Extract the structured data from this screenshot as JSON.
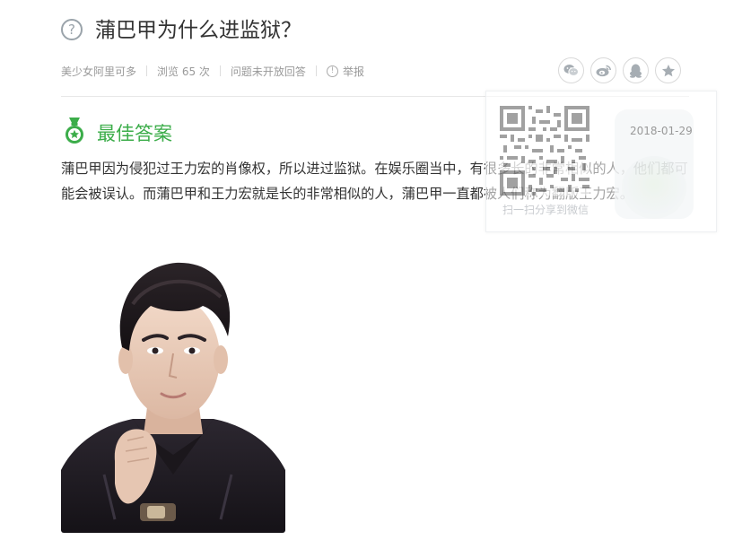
{
  "question": {
    "icon": "question-circle-icon",
    "title": "蒲巴甲为什么进监狱？"
  },
  "meta": {
    "author": "美少女阿里可多",
    "views": "浏览 65 次",
    "status": "问题未开放回答",
    "report_label": "举报"
  },
  "share": {
    "icons": [
      "wechat-icon",
      "weibo-icon",
      "qq-icon",
      "favorite-star-icon"
    ]
  },
  "qr_overlay": {
    "caption": "扫一扫分享到微信",
    "date": "2018-01-29"
  },
  "best_answer": {
    "icon": "medal-icon",
    "title": "最佳答案",
    "text": "蒲巴甲因为侵犯过王力宏的肖像权，所以进过监狱。在娱乐圈当中，有很多长的非常相似的人，他们都可能会被误认。而蒲巴甲和王力宏就是长的非常相似的人，蒲巴甲一直都被人们称为翻版王力宏。",
    "image": "portrait-photo"
  },
  "colors": {
    "accent_green": "#3cad4a",
    "text": "#333333",
    "muted": "#999999"
  }
}
